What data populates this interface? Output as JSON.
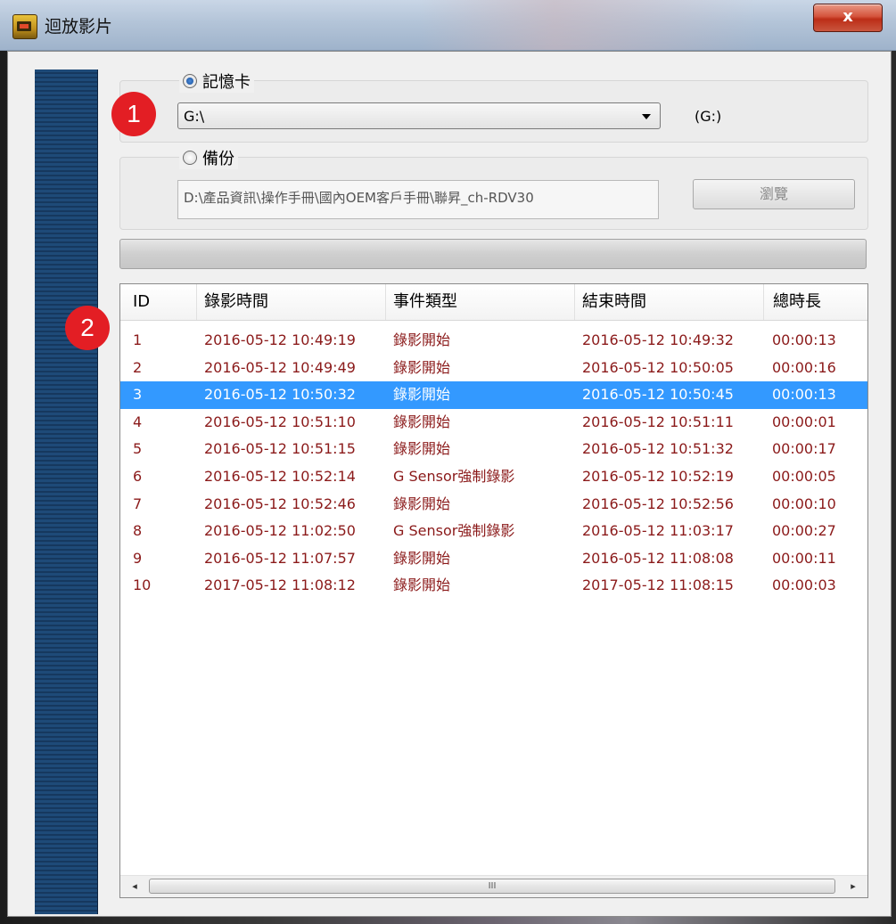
{
  "window": {
    "title": "迴放影片",
    "close_label": "x"
  },
  "memory_card": {
    "label": "記憶卡",
    "selected": true,
    "drive_value": "G:\\",
    "drive_display": "(G:)"
  },
  "backup": {
    "label": "備份",
    "selected": false,
    "path": "D:\\產品資訊\\操作手冊\\國內OEM客戶手冊\\聯昇_ch-RDV30",
    "browse_label": "瀏覽"
  },
  "progress": {
    "value": 0
  },
  "list": {
    "columns": [
      "ID",
      "錄影時間",
      "事件類型",
      "結束時間",
      "總時長"
    ],
    "selected_index": 2,
    "rows": [
      [
        "1",
        "2016-05-12 10:49:19",
        "錄影開始",
        "2016-05-12 10:49:32",
        "00:00:13"
      ],
      [
        "2",
        "2016-05-12 10:49:49",
        "錄影開始",
        "2016-05-12 10:50:05",
        "00:00:16"
      ],
      [
        "3",
        "2016-05-12 10:50:32",
        "錄影開始",
        "2016-05-12 10:50:45",
        "00:00:13"
      ],
      [
        "4",
        "2016-05-12 10:51:10",
        "錄影開始",
        "2016-05-12 10:51:11",
        "00:00:01"
      ],
      [
        "5",
        "2016-05-12 10:51:15",
        "錄影開始",
        "2016-05-12 10:51:32",
        "00:00:17"
      ],
      [
        "6",
        "2016-05-12 10:52:14",
        "G Sensor強制錄影",
        "2016-05-12 10:52:19",
        "00:00:05"
      ],
      [
        "7",
        "2016-05-12 10:52:46",
        "錄影開始",
        "2016-05-12 10:52:56",
        "00:00:10"
      ],
      [
        "8",
        "2016-05-12 11:02:50",
        "G Sensor強制錄影",
        "2016-05-12 11:03:17",
        "00:00:27"
      ],
      [
        "9",
        "2016-05-12 11:07:57",
        "錄影開始",
        "2016-05-12 11:08:08",
        "00:00:11"
      ],
      [
        "10",
        "2017-05-12 11:08:12",
        "錄影開始",
        "2017-05-12 11:08:15",
        "00:00:03"
      ]
    ]
  },
  "scrollbar": {
    "left_arrow": "◂",
    "right_arrow": "▸",
    "grip": "III"
  },
  "callouts": {
    "one": "1",
    "two": "2"
  },
  "colors": {
    "row_text": "#8b1a1a",
    "selection": "#3399ff",
    "callout": "#e31e24"
  }
}
